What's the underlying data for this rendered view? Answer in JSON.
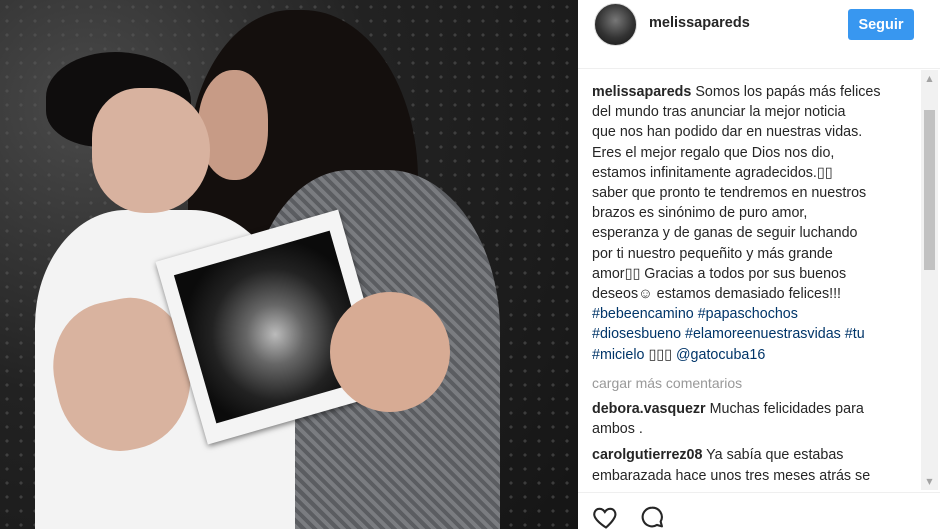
{
  "post": {
    "username": "melissapareds",
    "follow_label": "Seguir",
    "caption_lines": [
      "Somos los papás más felices",
      "del mundo tras anunciar la mejor noticia",
      "que nos han podido dar en nuestras vidas.",
      "Eres el mejor regalo que Dios nos dio,",
      "estamos infinitamente agradecidos.▯▯",
      "saber que pronto te tendremos en nuestros",
      "brazos es sinónimo de puro amor,",
      "esperanza y de ganas de seguir luchando",
      "por ti nuestro pequeñito y más grande",
      "amor▯▯ Gracias a todos por sus buenos",
      "deseos☺ estamos demasiado felices!!!"
    ],
    "hashtags": {
      "line1": [
        "#bebeencamino",
        "#papaschochos"
      ],
      "line2": [
        "#diosesbueno",
        "#elamoreenuestrasvidas",
        "#tu"
      ],
      "line3_tag": "#micielo",
      "line3_emoji": "▯▯▯",
      "line3_mention": "@gatocuba16"
    },
    "load_more_label": "cargar más comentarios",
    "comments": [
      {
        "user": "debora.vasquezr",
        "text": "Muchas felicidades para",
        "text2": "ambos ."
      },
      {
        "user": "carolgutierrez08",
        "text": "Ya sabía que estabas",
        "text2": "embarazada hace unos tres meses atrás se"
      }
    ]
  },
  "icons": {
    "like": "heart-icon",
    "comment": "comment-bubble-icon",
    "scroll_up": "scroll-up-arrow",
    "scroll_down": "scroll-down-arrow"
  },
  "colors": {
    "follow_button": "#3897f0",
    "hashtag": "#003569",
    "muted": "#999999"
  }
}
